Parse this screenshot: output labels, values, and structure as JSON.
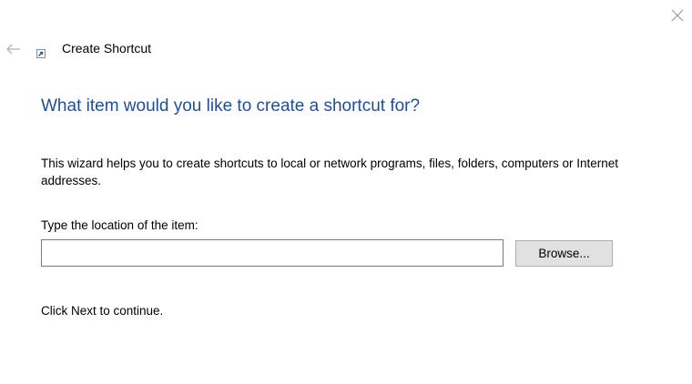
{
  "window": {
    "title": "Create Shortcut",
    "close_icon": "close-icon",
    "back_icon": "back-arrow-icon",
    "title_icon": "shortcut-icon"
  },
  "main": {
    "heading": "What item would you like to create a shortcut for?",
    "description": "This wizard helps you to create shortcuts to local or network programs, files, folders, computers or Internet addresses.",
    "location_label": "Type the location of the item:",
    "location_value": "",
    "browse_label": "Browse...",
    "footer_hint": "Click Next to continue."
  },
  "colors": {
    "heading": "#1f4e99",
    "background": "#ffffff",
    "button_face": "#e1e1e1"
  }
}
